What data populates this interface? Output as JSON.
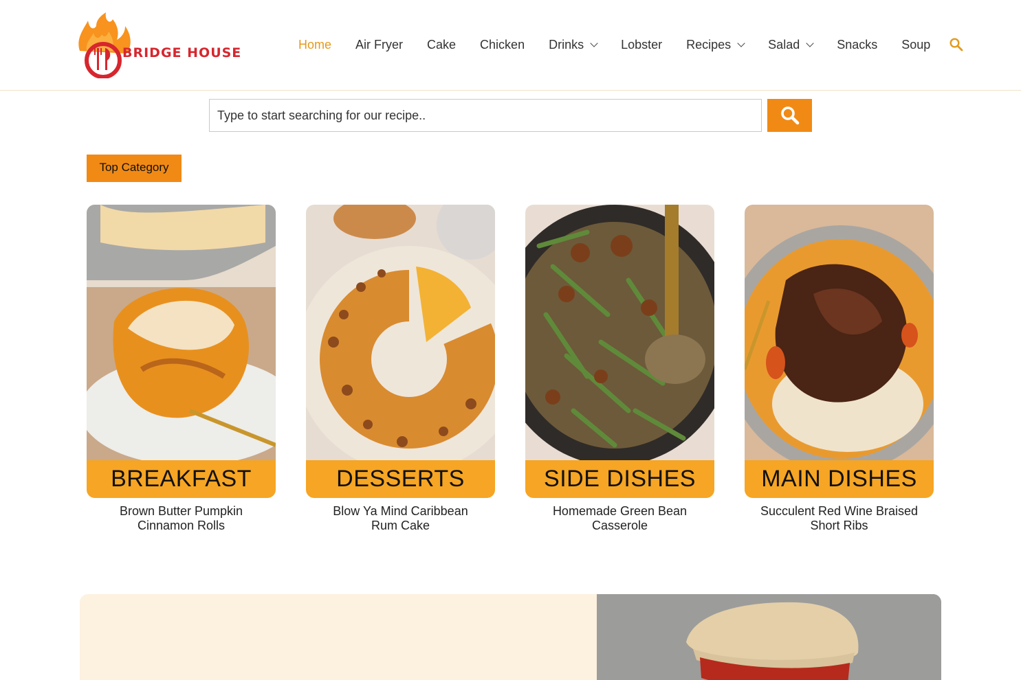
{
  "brand": {
    "name": "BRIDGE HOUSE"
  },
  "nav": {
    "items": [
      {
        "label": "Home",
        "active": true,
        "dropdown": false
      },
      {
        "label": "Air Fryer",
        "active": false,
        "dropdown": false
      },
      {
        "label": "Cake",
        "active": false,
        "dropdown": false
      },
      {
        "label": "Chicken",
        "active": false,
        "dropdown": false
      },
      {
        "label": "Drinks",
        "active": false,
        "dropdown": true
      },
      {
        "label": "Lobster",
        "active": false,
        "dropdown": false
      },
      {
        "label": "Recipes",
        "active": false,
        "dropdown": true
      },
      {
        "label": "Salad",
        "active": false,
        "dropdown": true
      },
      {
        "label": "Snacks",
        "active": false,
        "dropdown": false
      },
      {
        "label": "Soup",
        "active": false,
        "dropdown": false
      }
    ],
    "search_icon": "search-icon"
  },
  "search": {
    "placeholder": "Type to start searching for our recipe..",
    "value": "",
    "button_icon": "search-icon"
  },
  "section": {
    "label": "Top Category"
  },
  "cards": [
    {
      "category": "BREAKFAST",
      "title": "Brown Butter Pumpkin Cinnamon Rolls"
    },
    {
      "category": "DESSERTS",
      "title": "Blow Ya Mind Caribbean Rum Cake"
    },
    {
      "category": "SIDE DISHES",
      "title": "Homemade Green Bean Casserole"
    },
    {
      "category": "MAIN DISHES",
      "title": "Succulent Red Wine Braised Short Ribs"
    }
  ],
  "colors": {
    "accent": "#f18a15",
    "label_bg": "#f6a524",
    "active_nav": "#e39a1c",
    "brand_red": "#d7262e",
    "banner_bg": "#fdf1e0"
  }
}
